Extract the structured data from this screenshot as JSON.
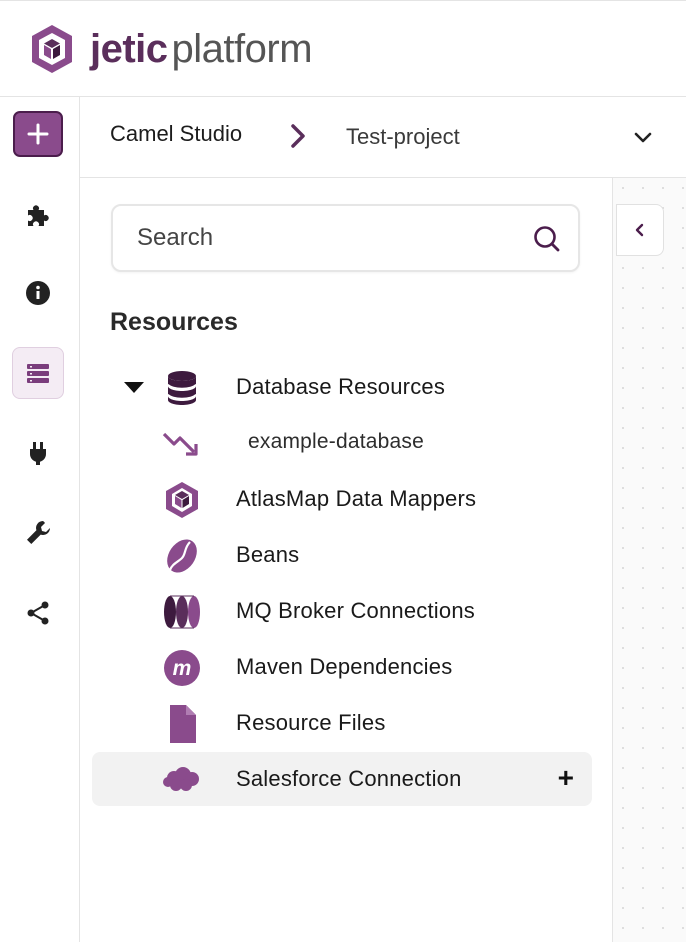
{
  "brand": {
    "name_bold": "jetic",
    "name_light": "platform"
  },
  "breadcrumb": {
    "root": "Camel Studio",
    "current": "Test-project"
  },
  "search": {
    "placeholder": "Search"
  },
  "resources": {
    "title": "Resources",
    "items": [
      {
        "label": "Database Resources",
        "icon": "database-icon",
        "expanded": true
      },
      {
        "label": "example-database",
        "icon": "trend-down-arrow-icon",
        "child": true
      },
      {
        "label": "AtlasMap Data Mappers",
        "icon": "atlasmap-cube-icon"
      },
      {
        "label": "Beans",
        "icon": "coffee-bean-icon"
      },
      {
        "label": "MQ Broker Connections",
        "icon": "mq-broker-icon"
      },
      {
        "label": "Maven Dependencies",
        "icon": "maven-m-icon"
      },
      {
        "label": "Resource Files",
        "icon": "file-icon"
      },
      {
        "label": "Salesforce Connection",
        "icon": "salesforce-cloud-icon",
        "hovered": true,
        "action": "+"
      }
    ]
  },
  "rail": [
    "plus-icon",
    "puzzle-icon",
    "info-icon",
    "list-icon",
    "plug-icon",
    "wrench-icon",
    "share-icon"
  ],
  "colors": {
    "accent": "#5a2e5b",
    "icon_purple": "#8a4b8c",
    "dark_purple": "#3d1a3e"
  }
}
